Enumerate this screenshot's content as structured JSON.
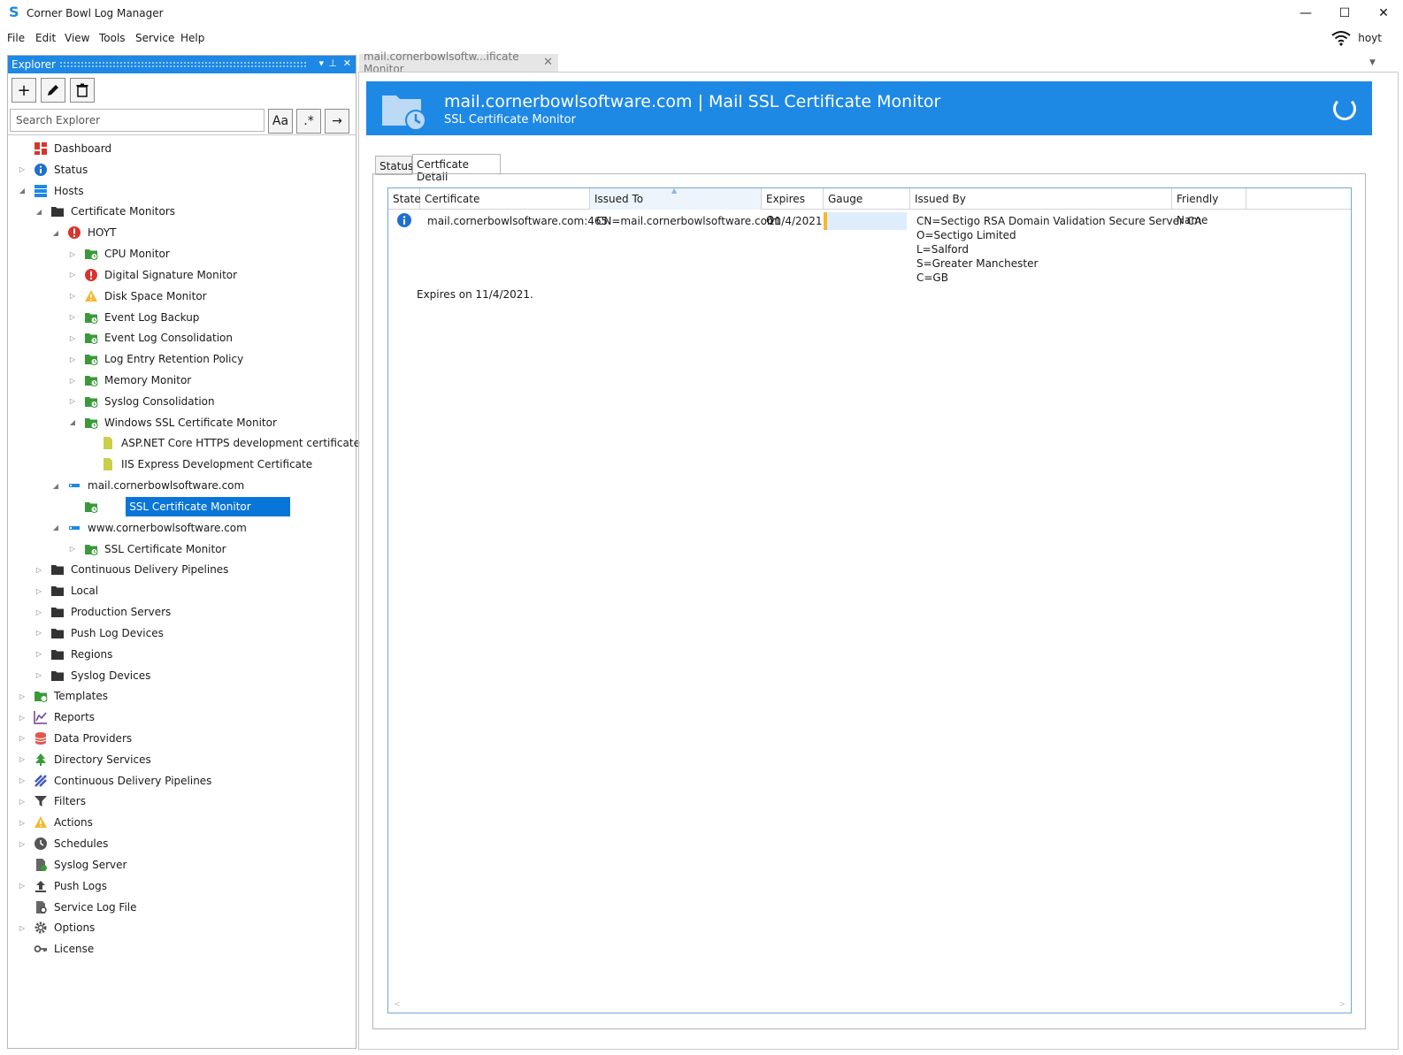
{
  "window": {
    "title": "Corner Bowl Log Manager",
    "minimize": "—",
    "maximize": "☐",
    "close": "✕"
  },
  "menu": [
    "File",
    "Edit",
    "View",
    "Tools",
    "Service",
    "Help"
  ],
  "user": {
    "name": "hoyt"
  },
  "explorer": {
    "title": "Explorer",
    "search_placeholder": "Search Explorer",
    "match_case_label": "Aa",
    "regex_label": ".*",
    "go_label": "→",
    "tree": [
      {
        "label": "Dashboard",
        "icon": "dashboard-icon"
      },
      {
        "label": "Status",
        "icon": "info-icon"
      },
      {
        "label": "Hosts",
        "icon": "hosts-icon"
      },
      {
        "label": "Certificate Monitors",
        "icon": "folder-open-icon"
      },
      {
        "label": "HOYT",
        "icon": "error-icon"
      },
      {
        "label": "CPU Monitor",
        "icon": "monitor-folder-icon"
      },
      {
        "label": "Digital Signature Monitor",
        "icon": "error-icon"
      },
      {
        "label": "Disk Space Monitor",
        "icon": "warning-icon"
      },
      {
        "label": "Event Log Backup",
        "icon": "monitor-folder-icon"
      },
      {
        "label": "Event Log Consolidation",
        "icon": "monitor-folder-icon"
      },
      {
        "label": "Log Entry Retention Policy",
        "icon": "monitor-folder-icon"
      },
      {
        "label": "Memory Monitor",
        "icon": "monitor-folder-icon"
      },
      {
        "label": "Syslog Consolidation",
        "icon": "monitor-folder-icon"
      },
      {
        "label": "Windows SSL Certificate Monitor",
        "icon": "monitor-folder-icon"
      },
      {
        "label": "ASP.NET Core HTTPS development certificate",
        "icon": "certificate-icon"
      },
      {
        "label": "IIS Express Development Certificate",
        "icon": "certificate-icon"
      },
      {
        "label": "mail.cornerbowlsoftware.com",
        "icon": "host-icon"
      },
      {
        "label": "Mail SSL Certificate Monitor",
        "icon": "monitor-folder-icon"
      },
      {
        "label": "www.cornerbowlsoftware.com",
        "icon": "host-icon"
      },
      {
        "label": "SSL Certificate Monitor",
        "icon": "monitor-folder-icon"
      },
      {
        "label": "Continuous Delivery Pipelines",
        "icon": "folder-icon"
      },
      {
        "label": "Local",
        "icon": "folder-icon"
      },
      {
        "label": "Production Servers",
        "icon": "folder-icon"
      },
      {
        "label": "Push Log Devices",
        "icon": "folder-icon"
      },
      {
        "label": "Regions",
        "icon": "folder-icon"
      },
      {
        "label": "Syslog Devices",
        "icon": "folder-icon"
      },
      {
        "label": "Templates",
        "icon": "templates-icon"
      },
      {
        "label": "Reports",
        "icon": "reports-icon"
      },
      {
        "label": "Data Providers",
        "icon": "database-icon"
      },
      {
        "label": "Directory Services",
        "icon": "tree-icon"
      },
      {
        "label": "Continuous Delivery Pipelines",
        "icon": "pipeline-icon"
      },
      {
        "label": "Filters",
        "icon": "filter-icon"
      },
      {
        "label": "Actions",
        "icon": "warning-icon"
      },
      {
        "label": "Schedules",
        "icon": "clock-icon"
      },
      {
        "label": "Syslog Server",
        "icon": "syslog-icon"
      },
      {
        "label": "Push Logs",
        "icon": "upload-icon"
      },
      {
        "label": "Service Log File",
        "icon": "file-gear-icon"
      },
      {
        "label": "Options",
        "icon": "gear-icon"
      },
      {
        "label": "License",
        "icon": "key-icon"
      }
    ]
  },
  "document": {
    "tab_label": "mail.cornerbowlsoftw...ificate Monitor",
    "tab_close": "✕",
    "banner_title": "mail.cornerbowlsoftware.com | Mail SSL Certificate Monitor",
    "banner_subtitle": "SSL Certificate Monitor",
    "tabs": [
      "Status",
      "Certficate Detail"
    ],
    "grid": {
      "columns": [
        "State",
        "Certificate",
        "Issued To",
        "Expires On",
        "Gauge",
        "Issued By",
        "Friendly Name"
      ],
      "row": {
        "state_icon": "info-icon",
        "certificate": "mail.cornerbowlsoftware.com:465",
        "issued_to": "CN=mail.cornerbowlsoftware.com",
        "expires_on": "11/4/2021",
        "gauge_fraction": 0.04,
        "issued_by": [
          "CN=Sectigo RSA Domain Validation Secure Server CA",
          "O=Sectigo Limited",
          "L=Salford",
          "S=Greater Manchester",
          "C=GB"
        ],
        "friendly_name": "",
        "detail": "Expires on 11/4/2021."
      }
    }
  },
  "colors": {
    "accent": "#1e88e5",
    "selection": "#0a75d8",
    "gauge": "#f5b82e",
    "gauge_track": "#deedfb"
  }
}
